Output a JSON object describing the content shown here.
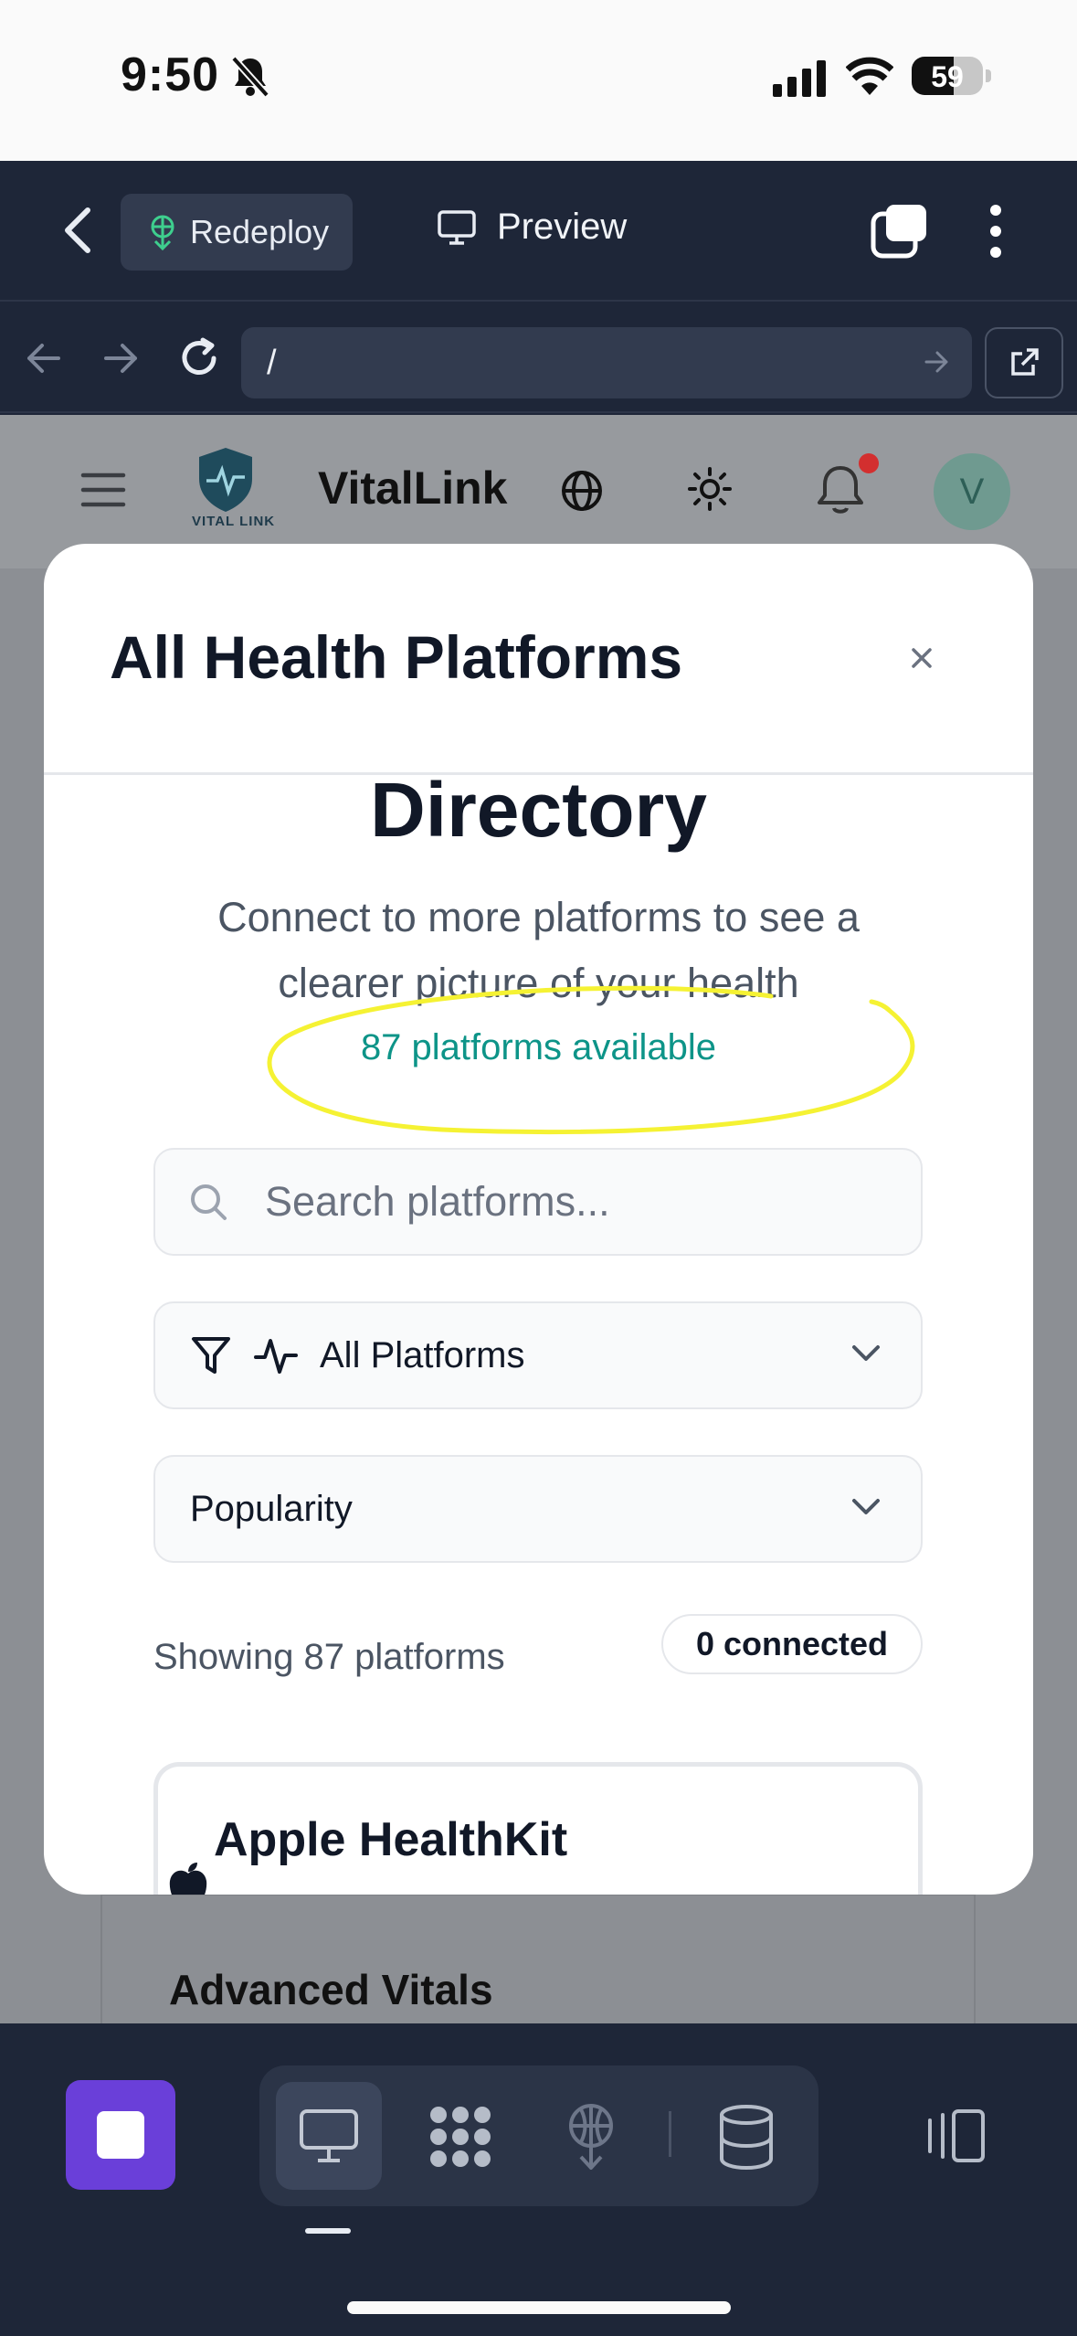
{
  "status_bar": {
    "time": "9:50",
    "battery_level": "59"
  },
  "editor_bar": {
    "redeploy_label": "Redeploy",
    "preview_label": "Preview"
  },
  "url_bar": {
    "path": "/"
  },
  "site": {
    "brand": "VitalLink",
    "logo_caption": "VITAL LINK",
    "avatar_initial": "V",
    "background_card_title": "Advanced Vitals"
  },
  "modal": {
    "title": "All Health Platforms",
    "close_glyph": "×",
    "directory_heading": "Directory",
    "subtitle": "Connect to more platforms to see a clearer picture of your health",
    "available_count": "87 platforms available",
    "search_placeholder": "Search platforms...",
    "filter_label": "All Platforms",
    "sort_label": "Popularity",
    "showing_text": "Showing 87 platforms",
    "connected_badge": "0 connected",
    "first_platform": "Apple HealthKit"
  },
  "colors": {
    "accent_teal": "#0d9488",
    "highlight_yellow": "#f5f233",
    "stop_button": "#6a3fd9",
    "editor_bg": "#1e2638"
  },
  "icons": [
    "bell-slash-icon",
    "signal-icon",
    "wifi-icon",
    "back-chevron-icon",
    "deploy-icon",
    "monitor-icon",
    "tabs-icon",
    "kebab-icon",
    "arrow-left-icon",
    "arrow-right-icon",
    "reload-icon",
    "external-link-icon",
    "hamburger-icon",
    "globe-icon",
    "sun-icon",
    "bell-icon",
    "close-icon",
    "search-icon",
    "filter-icon",
    "activity-icon",
    "chevron-down-icon",
    "apple-icon",
    "stop-icon",
    "desktop-icon",
    "apps-grid-icon",
    "database-icon",
    "panel-icon"
  ]
}
